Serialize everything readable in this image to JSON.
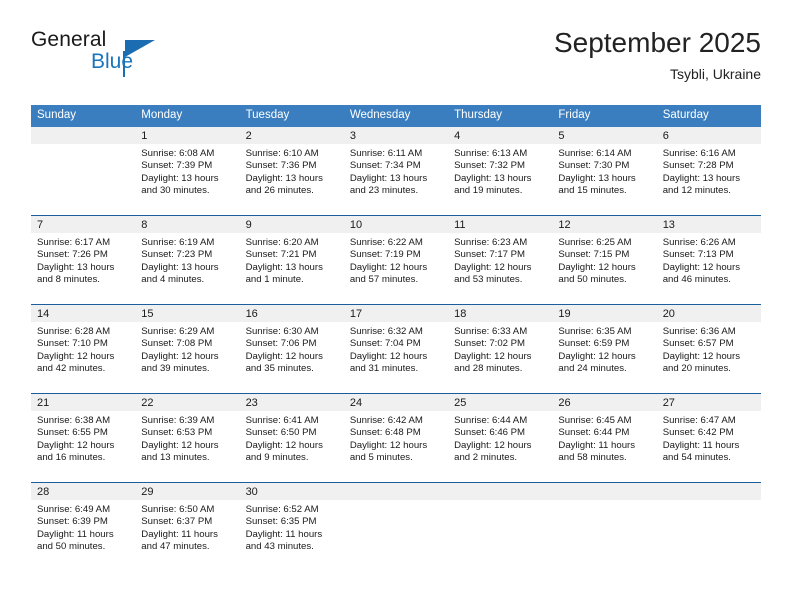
{
  "brand": {
    "line1": "General",
    "line2": "Blue",
    "accent_color": "#1b6cb0"
  },
  "header": {
    "month_title": "September 2025",
    "location": "Tsybli, Ukraine"
  },
  "calendar": {
    "header_bg": "#3a7ebf",
    "day_strip_bg": "#f0f0f0",
    "row_divider_color": "#1b5e9e",
    "weekdays": [
      "Sunday",
      "Monday",
      "Tuesday",
      "Wednesday",
      "Thursday",
      "Friday",
      "Saturday"
    ],
    "weeks": [
      [
        {
          "day": "",
          "empty": true
        },
        {
          "day": "1",
          "sunrise": "Sunrise: 6:08 AM",
          "sunset": "Sunset: 7:39 PM",
          "daylight1": "Daylight: 13 hours",
          "daylight2": "and 30 minutes."
        },
        {
          "day": "2",
          "sunrise": "Sunrise: 6:10 AM",
          "sunset": "Sunset: 7:36 PM",
          "daylight1": "Daylight: 13 hours",
          "daylight2": "and 26 minutes."
        },
        {
          "day": "3",
          "sunrise": "Sunrise: 6:11 AM",
          "sunset": "Sunset: 7:34 PM",
          "daylight1": "Daylight: 13 hours",
          "daylight2": "and 23 minutes."
        },
        {
          "day": "4",
          "sunrise": "Sunrise: 6:13 AM",
          "sunset": "Sunset: 7:32 PM",
          "daylight1": "Daylight: 13 hours",
          "daylight2": "and 19 minutes."
        },
        {
          "day": "5",
          "sunrise": "Sunrise: 6:14 AM",
          "sunset": "Sunset: 7:30 PM",
          "daylight1": "Daylight: 13 hours",
          "daylight2": "and 15 minutes."
        },
        {
          "day": "6",
          "sunrise": "Sunrise: 6:16 AM",
          "sunset": "Sunset: 7:28 PM",
          "daylight1": "Daylight: 13 hours",
          "daylight2": "and 12 minutes."
        }
      ],
      [
        {
          "day": "7",
          "sunrise": "Sunrise: 6:17 AM",
          "sunset": "Sunset: 7:26 PM",
          "daylight1": "Daylight: 13 hours",
          "daylight2": "and 8 minutes."
        },
        {
          "day": "8",
          "sunrise": "Sunrise: 6:19 AM",
          "sunset": "Sunset: 7:23 PM",
          "daylight1": "Daylight: 13 hours",
          "daylight2": "and 4 minutes."
        },
        {
          "day": "9",
          "sunrise": "Sunrise: 6:20 AM",
          "sunset": "Sunset: 7:21 PM",
          "daylight1": "Daylight: 13 hours",
          "daylight2": "and 1 minute."
        },
        {
          "day": "10",
          "sunrise": "Sunrise: 6:22 AM",
          "sunset": "Sunset: 7:19 PM",
          "daylight1": "Daylight: 12 hours",
          "daylight2": "and 57 minutes."
        },
        {
          "day": "11",
          "sunrise": "Sunrise: 6:23 AM",
          "sunset": "Sunset: 7:17 PM",
          "daylight1": "Daylight: 12 hours",
          "daylight2": "and 53 minutes."
        },
        {
          "day": "12",
          "sunrise": "Sunrise: 6:25 AM",
          "sunset": "Sunset: 7:15 PM",
          "daylight1": "Daylight: 12 hours",
          "daylight2": "and 50 minutes."
        },
        {
          "day": "13",
          "sunrise": "Sunrise: 6:26 AM",
          "sunset": "Sunset: 7:13 PM",
          "daylight1": "Daylight: 12 hours",
          "daylight2": "and 46 minutes."
        }
      ],
      [
        {
          "day": "14",
          "sunrise": "Sunrise: 6:28 AM",
          "sunset": "Sunset: 7:10 PM",
          "daylight1": "Daylight: 12 hours",
          "daylight2": "and 42 minutes."
        },
        {
          "day": "15",
          "sunrise": "Sunrise: 6:29 AM",
          "sunset": "Sunset: 7:08 PM",
          "daylight1": "Daylight: 12 hours",
          "daylight2": "and 39 minutes."
        },
        {
          "day": "16",
          "sunrise": "Sunrise: 6:30 AM",
          "sunset": "Sunset: 7:06 PM",
          "daylight1": "Daylight: 12 hours",
          "daylight2": "and 35 minutes."
        },
        {
          "day": "17",
          "sunrise": "Sunrise: 6:32 AM",
          "sunset": "Sunset: 7:04 PM",
          "daylight1": "Daylight: 12 hours",
          "daylight2": "and 31 minutes."
        },
        {
          "day": "18",
          "sunrise": "Sunrise: 6:33 AM",
          "sunset": "Sunset: 7:02 PM",
          "daylight1": "Daylight: 12 hours",
          "daylight2": "and 28 minutes."
        },
        {
          "day": "19",
          "sunrise": "Sunrise: 6:35 AM",
          "sunset": "Sunset: 6:59 PM",
          "daylight1": "Daylight: 12 hours",
          "daylight2": "and 24 minutes."
        },
        {
          "day": "20",
          "sunrise": "Sunrise: 6:36 AM",
          "sunset": "Sunset: 6:57 PM",
          "daylight1": "Daylight: 12 hours",
          "daylight2": "and 20 minutes."
        }
      ],
      [
        {
          "day": "21",
          "sunrise": "Sunrise: 6:38 AM",
          "sunset": "Sunset: 6:55 PM",
          "daylight1": "Daylight: 12 hours",
          "daylight2": "and 16 minutes."
        },
        {
          "day": "22",
          "sunrise": "Sunrise: 6:39 AM",
          "sunset": "Sunset: 6:53 PM",
          "daylight1": "Daylight: 12 hours",
          "daylight2": "and 13 minutes."
        },
        {
          "day": "23",
          "sunrise": "Sunrise: 6:41 AM",
          "sunset": "Sunset: 6:50 PM",
          "daylight1": "Daylight: 12 hours",
          "daylight2": "and 9 minutes."
        },
        {
          "day": "24",
          "sunrise": "Sunrise: 6:42 AM",
          "sunset": "Sunset: 6:48 PM",
          "daylight1": "Daylight: 12 hours",
          "daylight2": "and 5 minutes."
        },
        {
          "day": "25",
          "sunrise": "Sunrise: 6:44 AM",
          "sunset": "Sunset: 6:46 PM",
          "daylight1": "Daylight: 12 hours",
          "daylight2": "and 2 minutes."
        },
        {
          "day": "26",
          "sunrise": "Sunrise: 6:45 AM",
          "sunset": "Sunset: 6:44 PM",
          "daylight1": "Daylight: 11 hours",
          "daylight2": "and 58 minutes."
        },
        {
          "day": "27",
          "sunrise": "Sunrise: 6:47 AM",
          "sunset": "Sunset: 6:42 PM",
          "daylight1": "Daylight: 11 hours",
          "daylight2": "and 54 minutes."
        }
      ],
      [
        {
          "day": "28",
          "sunrise": "Sunrise: 6:49 AM",
          "sunset": "Sunset: 6:39 PM",
          "daylight1": "Daylight: 11 hours",
          "daylight2": "and 50 minutes."
        },
        {
          "day": "29",
          "sunrise": "Sunrise: 6:50 AM",
          "sunset": "Sunset: 6:37 PM",
          "daylight1": "Daylight: 11 hours",
          "daylight2": "and 47 minutes."
        },
        {
          "day": "30",
          "sunrise": "Sunrise: 6:52 AM",
          "sunset": "Sunset: 6:35 PM",
          "daylight1": "Daylight: 11 hours",
          "daylight2": "and 43 minutes."
        },
        {
          "day": "",
          "empty": true
        },
        {
          "day": "",
          "empty": true
        },
        {
          "day": "",
          "empty": true
        },
        {
          "day": "",
          "empty": true
        }
      ]
    ]
  }
}
